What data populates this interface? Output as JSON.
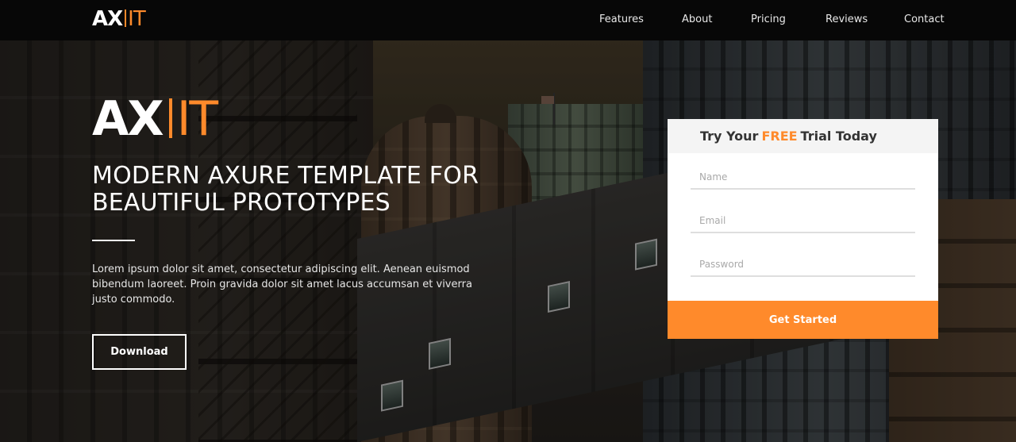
{
  "brand": {
    "logo_main": "AX",
    "logo_accent": "IT",
    "accent_color": "#ff8a2b"
  },
  "nav": {
    "items": [
      {
        "label": "Features"
      },
      {
        "label": "About"
      },
      {
        "label": "Pricing"
      },
      {
        "label": "Reviews"
      },
      {
        "label": "Contact"
      }
    ]
  },
  "hero": {
    "logo_main": "AX",
    "logo_accent": "IT",
    "headline_line1": "MODERN AXURE TEMPLATE FOR",
    "headline_line2": "BEAUTIFUL PROTOTYPES",
    "description": "Lorem ipsum dolor sit amet, consectetur adipiscing elit. Aenean euismod bibendum laoreet. Proin gravida dolor sit amet lacus accumsan et viverra justo commodo.",
    "download_label": "Download"
  },
  "signup": {
    "title_prefix": "Try Your",
    "title_highlight": "FREE",
    "title_suffix": "Trial Today",
    "name_placeholder": "Name",
    "email_placeholder": "Email",
    "password_placeholder": "Password",
    "submit_label": "Get Started"
  }
}
